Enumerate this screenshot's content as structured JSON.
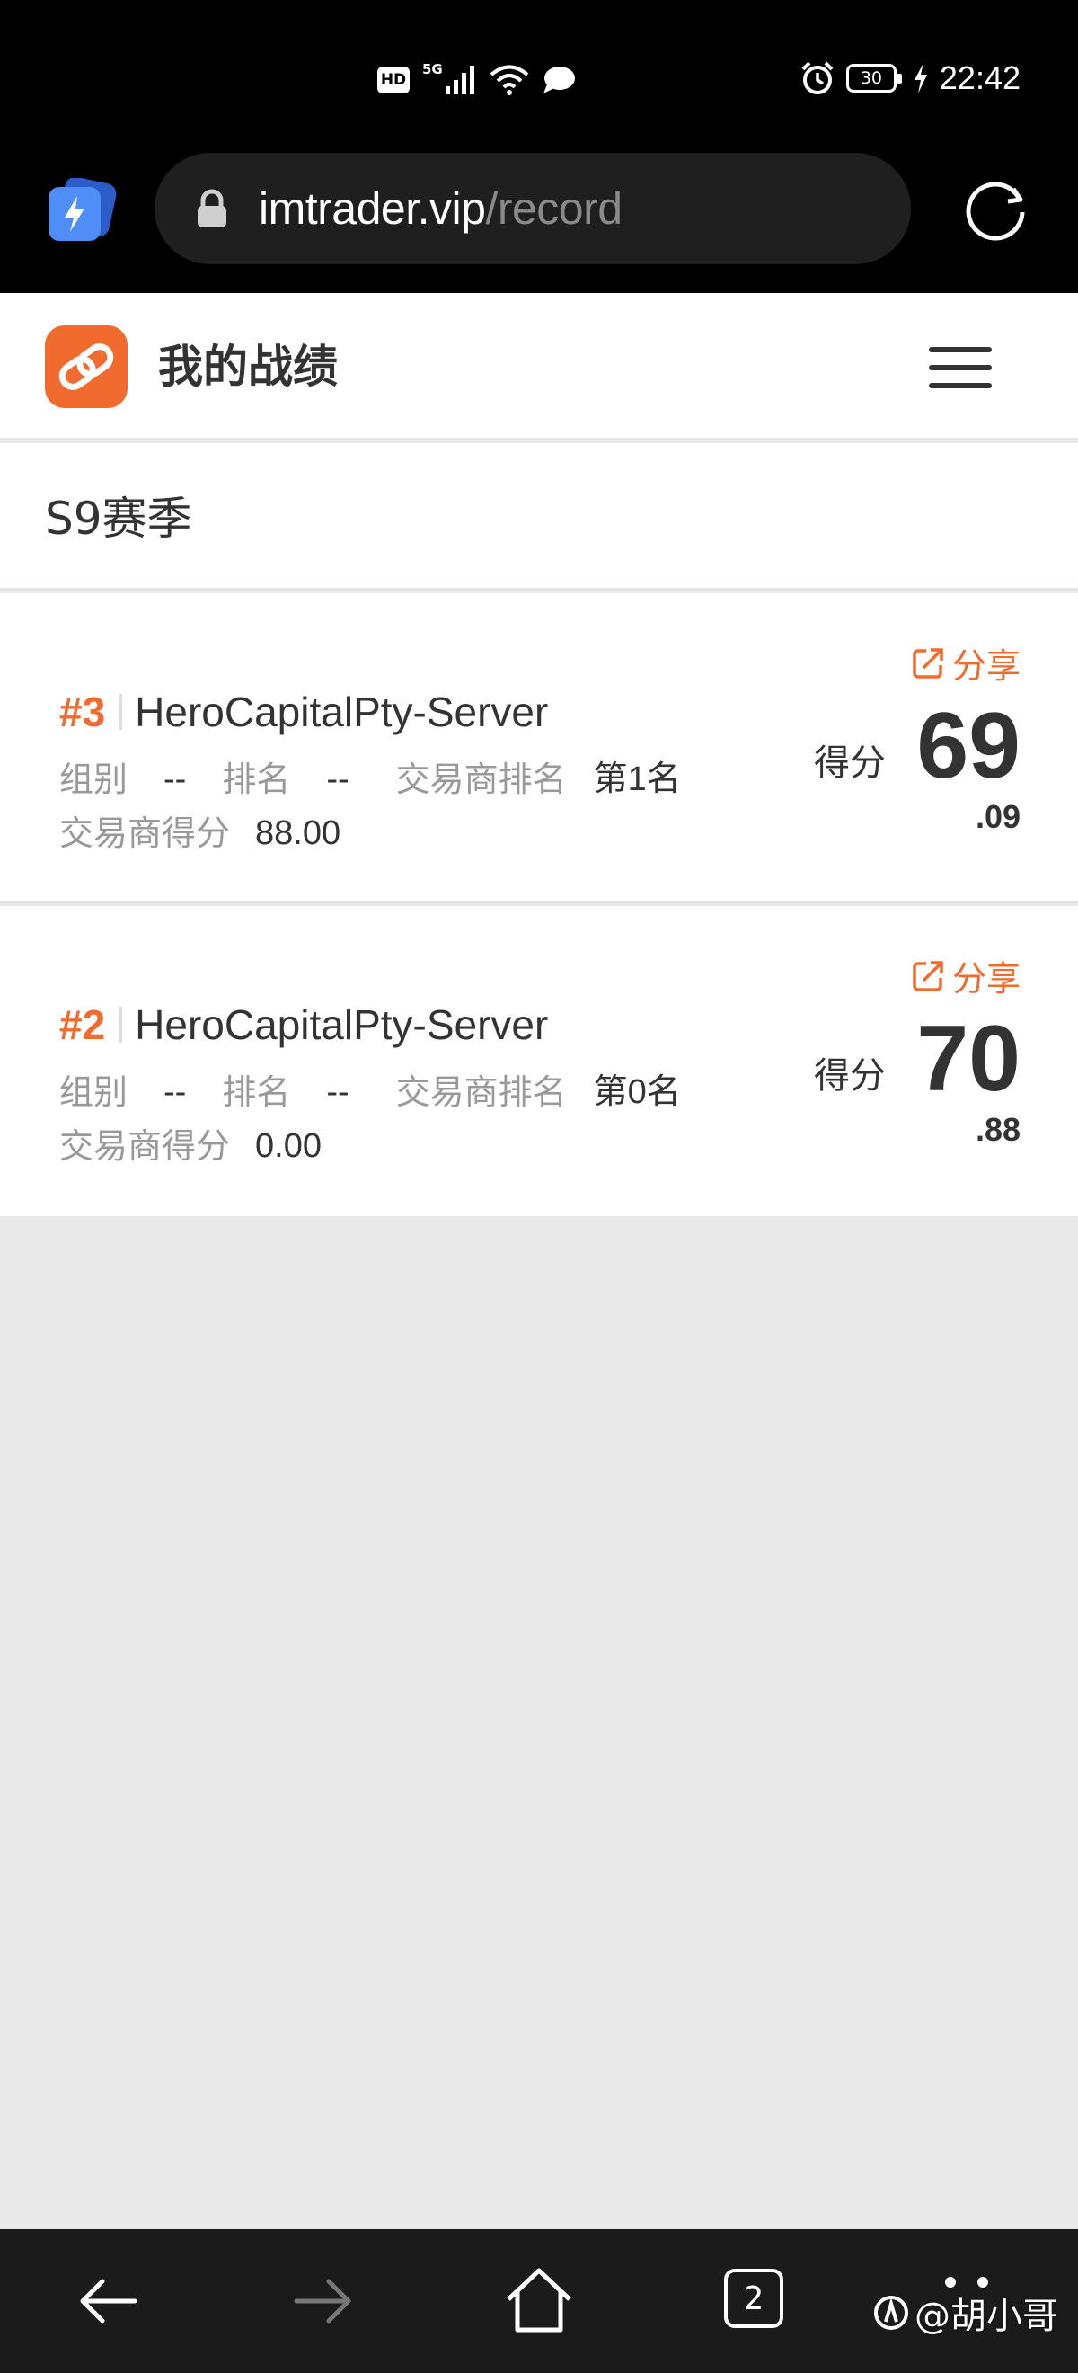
{
  "status_bar": {
    "hd": "HD",
    "network": "5G",
    "battery": "30",
    "time": "22:42",
    "icons": [
      "signal-icon",
      "wifi-icon",
      "message-icon",
      "alarm-icon",
      "battery-icon",
      "charging-icon"
    ]
  },
  "browser": {
    "url_domain": "imtrader.vip",
    "url_path": "/record",
    "icons": [
      "app-icon",
      "lock-icon",
      "reload-icon"
    ]
  },
  "header": {
    "title": "我的战绩",
    "icons": [
      "logo-icon",
      "menu-icon"
    ]
  },
  "season": {
    "label": "S9赛季"
  },
  "records": [
    {
      "rank": "#3",
      "server": "HeroCapitalPty-Server",
      "group_label": "组别",
      "group_value": "--",
      "rank_label": "排名",
      "rank_value": "--",
      "broker_rank_label": "交易商排名",
      "broker_rank_value": "第1名",
      "broker_score_label": "交易商得分",
      "broker_score_value": "88.00",
      "share_label": "分享",
      "score_label": "得分",
      "score_int": "69",
      "score_dec": ".09"
    },
    {
      "rank": "#2",
      "server": "HeroCapitalPty-Server",
      "group_label": "组别",
      "group_value": "--",
      "rank_label": "排名",
      "rank_value": "--",
      "broker_rank_label": "交易商排名",
      "broker_rank_value": "第0名",
      "broker_score_label": "交易商得分",
      "broker_score_value": "0.00",
      "share_label": "分享",
      "score_label": "得分",
      "score_int": "70",
      "score_dec": ".88"
    }
  ],
  "bottom_nav": {
    "tab_count": "2",
    "watermark": "@胡小哥",
    "icons": [
      "back-icon",
      "forward-icon",
      "home-icon",
      "tabs-icon",
      "more-icon"
    ]
  },
  "colors": {
    "accent": "#f06b2d",
    "text": "#333333",
    "muted": "#999999",
    "background": "#e9e9e9"
  }
}
